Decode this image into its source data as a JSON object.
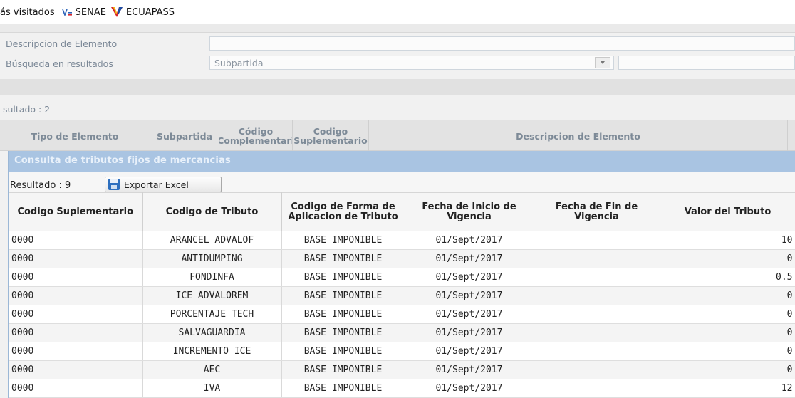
{
  "bookmarks": {
    "items": [
      {
        "label": "ás visitados",
        "icon": "none"
      },
      {
        "label": "SENAE",
        "icon": "senae-logo-icon"
      },
      {
        "label": "ECUAPASS",
        "icon": "ecuapass-logo-icon"
      }
    ]
  },
  "background_form": {
    "descripcion_label": "Descripcion de Elemento",
    "busqueda_label": "Búsqueda en resultados",
    "busqueda_select_value": "Subpartida",
    "resultado_label": "sultado : 2",
    "columns": [
      "Tipo de Elemento",
      "Subpartida",
      "Código Complementari",
      "Codigo Suplementario",
      "Descripcion de Elemento"
    ]
  },
  "modal": {
    "title": "Consulta de tributos fijos de mercancias",
    "result_count": "Resultado : 9",
    "export_label": "Exportar Excel",
    "columns": [
      "Codigo Suplementario",
      "Codigo de Tributo",
      "Codigo de Forma de Aplicacion de Tributo",
      "Fecha de Inicio de Vigencia",
      "Fecha de Fin de Vigencia",
      "Valor del Tributo"
    ],
    "rows": [
      [
        "0000",
        "ARANCEL ADVALOF",
        "BASE IMPONIBLE",
        "01/Sept/2017",
        "",
        "10"
      ],
      [
        "0000",
        "ANTIDUMPING",
        "BASE IMPONIBLE",
        "01/Sept/2017",
        "",
        "0"
      ],
      [
        "0000",
        "FONDINFA",
        "BASE IMPONIBLE",
        "01/Sept/2017",
        "",
        "0.5"
      ],
      [
        "0000",
        "ICE ADVALOREM",
        "BASE IMPONIBLE",
        "01/Sept/2017",
        "",
        "0"
      ],
      [
        "0000",
        "PORCENTAJE TECH",
        "BASE IMPONIBLE",
        "01/Sept/2017",
        "",
        "0"
      ],
      [
        "0000",
        "SALVAGUARDIA",
        "BASE IMPONIBLE",
        "01/Sept/2017",
        "",
        "0"
      ],
      [
        "0000",
        "INCREMENTO ICE",
        "BASE IMPONIBLE",
        "01/Sept/2017",
        "",
        "0"
      ],
      [
        "0000",
        "AEC",
        "BASE IMPONIBLE",
        "01/Sept/2017",
        "",
        "0"
      ],
      [
        "0000",
        "IVA",
        "BASE IMPONIBLE",
        "01/Sept/2017",
        "",
        "12"
      ]
    ]
  },
  "colors": {
    "modal_title_bg": "#a9c4e2",
    "ecuapass_red": "#d7262b",
    "ecuapass_yellow": "#f4c20d",
    "ecuapass_blue": "#1f4ea3"
  }
}
